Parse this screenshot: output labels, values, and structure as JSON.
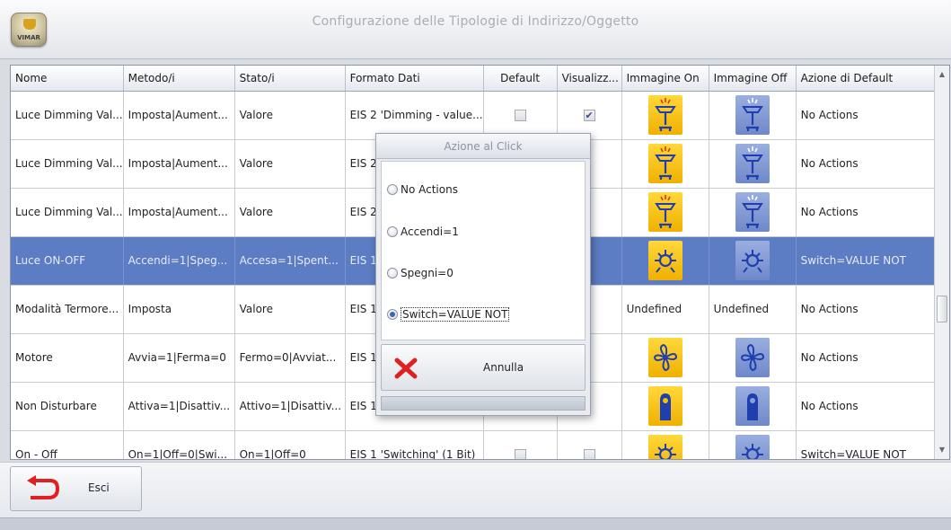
{
  "window": {
    "title": "Configurazione delle Tipologie di Indirizzo/Oggetto",
    "logo_text": "VIMAR"
  },
  "colors": {
    "selected_row": "#5c7cc4",
    "tile_on": "#f5c000",
    "tile_off": "#7a92cf",
    "cancel_x": "#e02020",
    "exit_arrow": "#e02020"
  },
  "table": {
    "columns": [
      "Nome",
      "Metodo/i",
      "Stato/i",
      "Formato Dati",
      "Default",
      "Visualizz...",
      "Immagine On",
      "Immagine Off",
      "Azione di Default"
    ],
    "rows": [
      {
        "nome": "Luce Dimming Val...",
        "metodo": "Imposta|Aument...",
        "stato": "Valore",
        "formato": "EIS 2 'Dimming - value...",
        "default": "unchecked",
        "visualizza": "checked",
        "img_on": "dimmer-lamp-icon",
        "img_off": "dimmer-lamp-icon",
        "azione": "No Actions",
        "selected": false
      },
      {
        "nome": "Luce Dimming Val...",
        "metodo": "Imposta|Aument...",
        "stato": "Valore",
        "formato": "EIS 2",
        "default": "",
        "visualizza": "",
        "img_on": "dimmer-lamp-icon",
        "img_off": "dimmer-lamp-icon",
        "azione": "No Actions",
        "selected": false
      },
      {
        "nome": "Luce Dimming Val...",
        "metodo": "Imposta|Aument...",
        "stato": "Valore",
        "formato": "EIS 2",
        "default": "",
        "visualizza": "",
        "img_on": "dimmer-lamp-icon",
        "img_off": "dimmer-lamp-icon",
        "azione": "No Actions",
        "selected": false
      },
      {
        "nome": "Luce ON-OFF",
        "metodo": "Accendi=1|Speg...",
        "stato": "Accesa=1|Spent...",
        "formato": "EIS 1",
        "default": "",
        "visualizza": "",
        "img_on": "light-bulb-icon",
        "img_off": "light-bulb-icon",
        "azione": "Switch=VALUE NOT",
        "selected": true
      },
      {
        "nome": "Modalità Termore...",
        "metodo": "Imposta",
        "stato": "Valore",
        "formato": "EIS 1",
        "default": "",
        "visualizza": "",
        "img_on_text": "Undefined",
        "img_off_text": "Undefined",
        "azione": "No Actions",
        "selected": false
      },
      {
        "nome": "Motore",
        "metodo": "Avvia=1|Ferma=0",
        "stato": "Fermo=0|Avviat...",
        "formato": "EIS 1",
        "default": "",
        "visualizza": "",
        "img_on": "fan-icon",
        "img_off": "fan-icon",
        "azione": "No Actions",
        "selected": false
      },
      {
        "nome": "Non Disturbare",
        "metodo": "Attiva=1|Disattiv...",
        "stato": "Attivo=1|Disattiv...",
        "formato": "EIS 1",
        "default": "",
        "visualizza": "",
        "img_on": "door-hanger-icon",
        "img_off": "door-hanger-icon",
        "azione": "No Actions",
        "selected": false
      },
      {
        "nome": "On - Off",
        "metodo": "On=1|Off=0|Swi...",
        "stato": "On=1|Off=0",
        "formato": "EIS 1 'Switching' (1 Bit)",
        "default": "unchecked",
        "visualizza": "unchecked",
        "img_on": "light-bulb-icon",
        "img_off": "light-bulb-icon",
        "azione": "Switch=VALUE NOT",
        "selected": false
      }
    ]
  },
  "dialog": {
    "title": "Azione al Click",
    "options": [
      "No Actions",
      "Accendi=1",
      "Spegni=0",
      "Switch=VALUE NOT"
    ],
    "selected_option": "Switch=VALUE NOT",
    "cancel_label": "Annulla"
  },
  "footer": {
    "exit_label": "Esci"
  }
}
